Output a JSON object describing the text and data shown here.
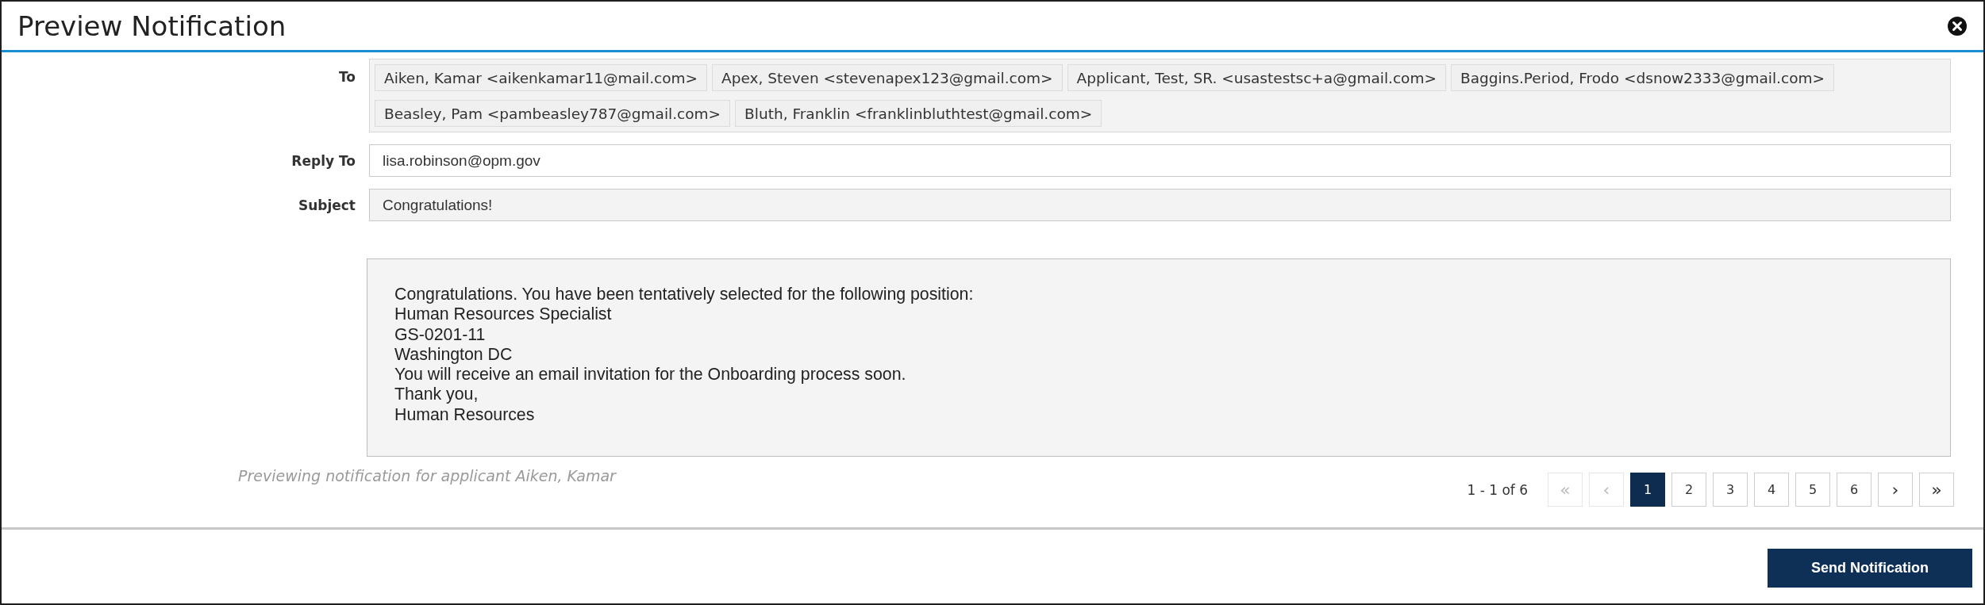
{
  "dialog": {
    "title": "Preview Notification"
  },
  "form": {
    "fields": [
      {
        "kind": "recipients",
        "label": "To",
        "recipients": [
          "Aiken, Kamar <aikenkamar11@mail.com>",
          "Apex, Steven <stevenapex123@gmail.com>",
          "Applicant, Test, SR. <usastestsc+a@gmail.com>",
          "Baggins.Period, Frodo <dsnow2333@gmail.com>",
          "Beasley, Pam <pambeasley787@gmail.com>",
          "Bluth, Franklin <franklinbluthtest@gmail.com>"
        ]
      },
      {
        "kind": "input",
        "label": "Reply To",
        "value": "lisa.robinson@opm.gov",
        "readonly": false
      },
      {
        "kind": "input",
        "label": "Subject",
        "value": "Congratulations!",
        "readonly": true
      }
    ]
  },
  "message": {
    "lines": [
      "Congratulations. You have been tentatively selected for the following position:",
      "Human Resources Specialist",
      "GS-0201-11",
      "Washington DC",
      "You will receive an email invitation for the Onboarding process soon.",
      "Thank you,",
      "Human Resources"
    ]
  },
  "status_text": "Previewing notification for applicant Aiken, Kamar",
  "pagination": {
    "summary": "1 - 1 of 6",
    "buttons": [
      {
        "kind": "first",
        "label": "«",
        "selected": false,
        "disabled": true
      },
      {
        "kind": "prev",
        "label": "‹",
        "selected": false,
        "disabled": true
      },
      {
        "kind": "page",
        "label": "1",
        "selected": true,
        "disabled": false
      },
      {
        "kind": "page",
        "label": "2",
        "selected": false,
        "disabled": false
      },
      {
        "kind": "page",
        "label": "3",
        "selected": false,
        "disabled": false
      },
      {
        "kind": "page",
        "label": "4",
        "selected": false,
        "disabled": false
      },
      {
        "kind": "page",
        "label": "5",
        "selected": false,
        "disabled": false
      },
      {
        "kind": "page",
        "label": "6",
        "selected": false,
        "disabled": false
      },
      {
        "kind": "next",
        "label": "›",
        "selected": false,
        "disabled": false
      },
      {
        "kind": "last",
        "label": "»",
        "selected": false,
        "disabled": false
      }
    ]
  },
  "send_button": {
    "label": "Send Notification"
  }
}
